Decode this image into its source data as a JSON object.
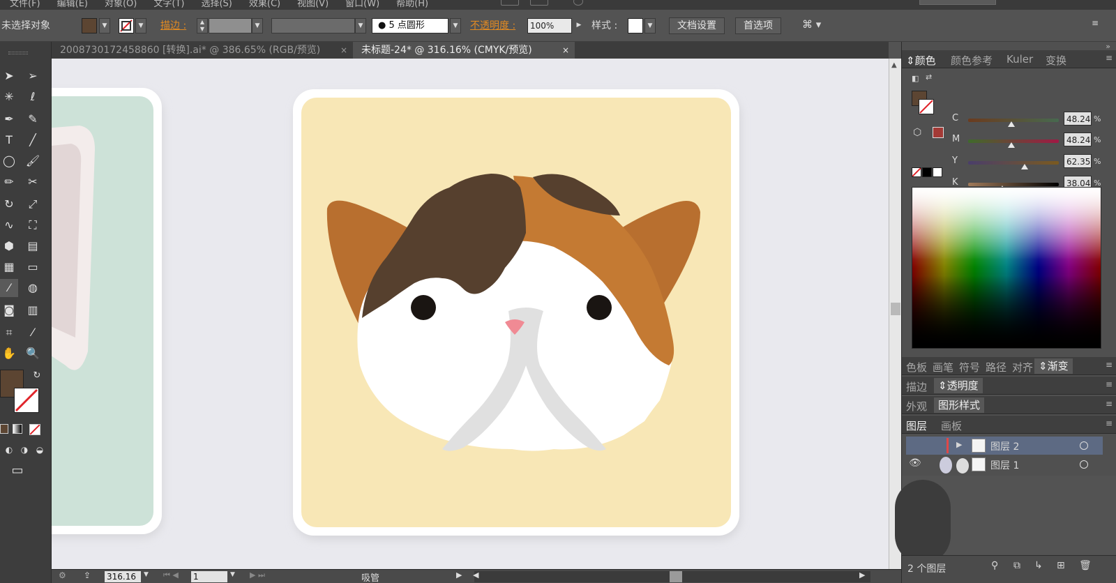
{
  "menubar": {
    "items": [
      "文件(F)",
      "编辑(E)",
      "对象(O)",
      "文字(T)",
      "选择(S)",
      "效果(C)",
      "视图(V)",
      "窗口(W)",
      "帮助(H)"
    ]
  },
  "control_bar": {
    "selection_status": "未选择对象",
    "fill_color": "#5c4532",
    "stroke_label": "描边 :",
    "brush_label": "5 点圆形",
    "opacity_label": "不透明度 :",
    "opacity_value": "100%",
    "style_label": "样式 :",
    "doc_setup_button": "文档设置",
    "preferences_button": "首选项"
  },
  "doc_tabs": [
    {
      "label": "2008730172458860 [转换].ai* @ 386.65% (RGB/预览)",
      "close": "×"
    },
    {
      "label": "未标题-24* @ 316.16% (CMYK/预览)",
      "close": "×"
    }
  ],
  "canvas": {
    "card_bg": "#f8e7b6",
    "left_card_bg": "#cde2d8",
    "colors": {
      "dark": "#56402e",
      "orange": "#c47a33",
      "ear": "#b86f2f",
      "white": "#ffffff",
      "gray": "#e0e0e0",
      "nose": "#f08a94"
    }
  },
  "status_bar": {
    "zoom": "316.16",
    "page": "1",
    "tool": "吸管"
  },
  "color_panel": {
    "tabs": [
      "颜色",
      "颜色参考",
      "Kuler",
      "变换"
    ],
    "sliders": [
      {
        "label": "C",
        "value": "48.24",
        "pos": 0.48
      },
      {
        "label": "M",
        "value": "48.24",
        "pos": 0.48
      },
      {
        "label": "Y",
        "value": "62.35",
        "pos": 0.62
      },
      {
        "label": "K",
        "value": "38.04",
        "pos": 0.38
      }
    ],
    "percent": "%"
  },
  "panel_groups": {
    "row1": [
      "色板",
      "画笔",
      "符号",
      "路径",
      "对齐",
      "渐变"
    ],
    "row2": [
      "描边",
      "透明度"
    ],
    "row3": [
      "外观",
      "图形样式"
    ],
    "row4": [
      "图层",
      "画板"
    ]
  },
  "layers": [
    {
      "name": "图层 2"
    },
    {
      "name": "图层 1"
    }
  ],
  "layers_footer": "2 个图层"
}
